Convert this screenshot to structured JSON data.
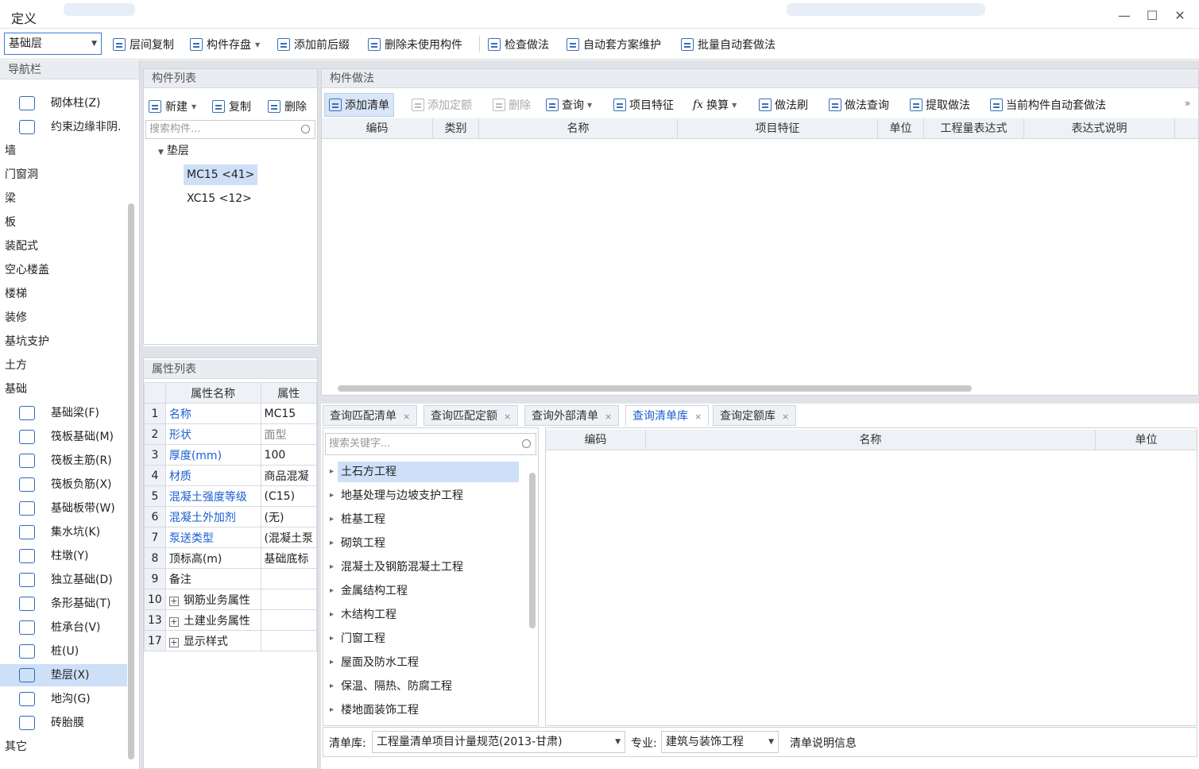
{
  "window": {
    "title": "定义",
    "min_glyph": "—",
    "max_glyph": "☐",
    "close_glyph": "✕"
  },
  "toolbar": {
    "floor_value": "基础层",
    "buttons": [
      "层间复制",
      "构件存盘",
      "添加前后缀",
      "删除未使用构件",
      "检查做法",
      "自动套方案维护",
      "批量自动套做法"
    ]
  },
  "nav": {
    "header": "导航栏",
    "top_items": [
      "砌体柱(Z)",
      "约束边缘非阴."
    ],
    "categories": [
      "墙",
      "门窗洞",
      "梁",
      "板",
      "装配式",
      "空心楼盖",
      "楼梯",
      "装修",
      "基坑支护",
      "土方",
      "基础"
    ],
    "foundation_items": [
      "基础梁(F)",
      "筏板基础(M)",
      "筏板主筋(R)",
      "筏板负筋(X)",
      "基础板带(W)",
      "集水坑(K)",
      "柱墩(Y)",
      "独立基础(D)",
      "条形基础(T)",
      "桩承台(V)",
      "桩(U)",
      "垫层(X)",
      "地沟(G)",
      "砖胎膜"
    ],
    "other": "其它"
  },
  "complist": {
    "header": "构件列表",
    "new_label": "新建",
    "copy_label": "复制",
    "delete_label": "删除",
    "search_placeholder": "搜索构件...",
    "root": "垫层",
    "children": [
      "MC15 <41>",
      "XC15 <12>"
    ]
  },
  "proplist": {
    "header": "属性列表",
    "col_name": "属性名称",
    "col_value": "属性",
    "rows": [
      {
        "n": "1",
        "name": "名称",
        "value": "MC15"
      },
      {
        "n": "2",
        "name": "形状",
        "value": "面型"
      },
      {
        "n": "3",
        "name": "厚度(mm)",
        "value": "100"
      },
      {
        "n": "4",
        "name": "材质",
        "value": "商品混凝"
      },
      {
        "n": "5",
        "name": "混凝土强度等级",
        "value": "(C15)"
      },
      {
        "n": "6",
        "name": "混凝土外加剂",
        "value": "(无)"
      },
      {
        "n": "7",
        "name": "泵送类型",
        "value": "(混凝土泵"
      },
      {
        "n": "8",
        "name": "顶标高(m)",
        "value": "基础底标"
      },
      {
        "n": "9",
        "name": "备注",
        "value": ""
      },
      {
        "n": "10",
        "name": "钢筋业务属性",
        "value": ""
      },
      {
        "n": "13",
        "name": "土建业务属性",
        "value": ""
      },
      {
        "n": "17",
        "name": "显示样式",
        "value": ""
      }
    ]
  },
  "method": {
    "header": "构件做法",
    "tools": [
      "添加清单",
      "添加定额",
      "删除",
      "查询",
      "项目特征",
      "换算",
      "做法刷",
      "做法查询",
      "提取做法",
      "当前构件自动套做法"
    ],
    "more_glyph": "»",
    "columns": [
      "编码",
      "类别",
      "名称",
      "项目特征",
      "单位",
      "工程量表达式",
      "表达式说明"
    ]
  },
  "tabs": [
    "查询匹配清单",
    "查询匹配定额",
    "查询外部清单",
    "查询清单库",
    "查询定额库"
  ],
  "tab_close": "×",
  "library": {
    "search_placeholder": "搜索关键字...",
    "items": [
      "土石方工程",
      "地基处理与边坡支护工程",
      "桩基工程",
      "砌筑工程",
      "混凝土及钢筋混凝土工程",
      "金属结构工程",
      "木结构工程",
      "门窗工程",
      "屋面及防水工程",
      "保温、隔热、防腐工程",
      "楼地面装饰工程"
    ],
    "columns": [
      "编码",
      "名称",
      "单位"
    ]
  },
  "bottombar": {
    "lib_label": "清单库:",
    "lib_value": "工程量清单项目计量规范(2013-甘肃)",
    "major_label": "专业:",
    "major_value": "建筑与装饰工程",
    "info_label": "清单说明信息"
  },
  "colors": {
    "accent": "#1a5fd1",
    "selected_bg": "#cde0f7",
    "icon_blue": "#2f6bb8"
  }
}
